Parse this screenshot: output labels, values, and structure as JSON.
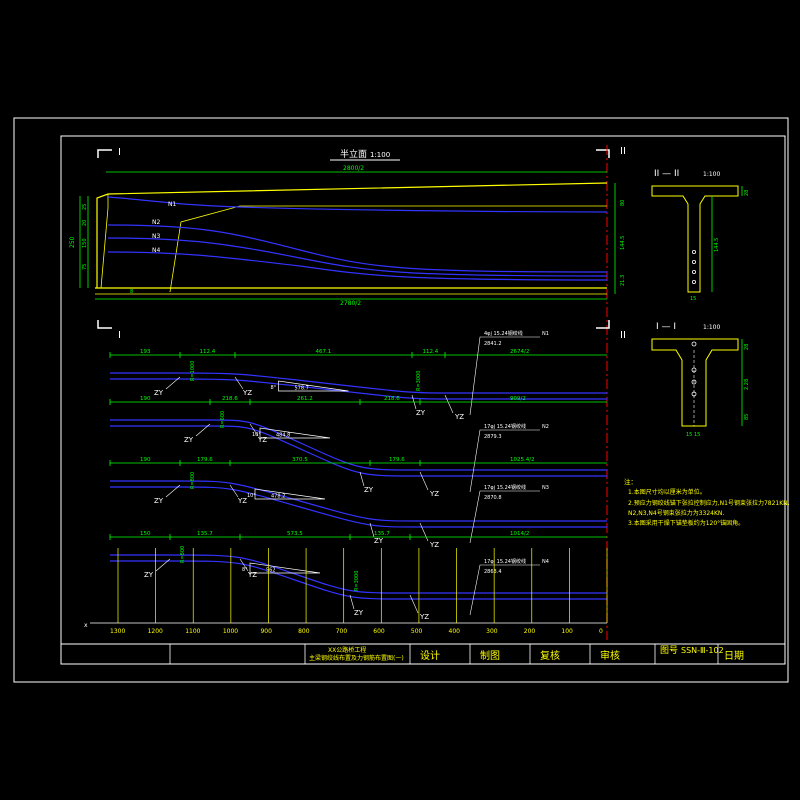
{
  "colors": {
    "background": "#000000",
    "border": "#ffffff",
    "frame": "#ffffff",
    "beam": "#ffff00",
    "tendon": "#3333ff",
    "dimension": "#00ff00",
    "text": "#ffffff",
    "note": "#ffff00",
    "centerline": "#ff0000"
  },
  "elevation": {
    "title": "半立面",
    "scale": "1:100",
    "top_length": "2800/2",
    "bottom_length": "2780/2",
    "left_marker": "I",
    "right_marker": "II",
    "tendons": [
      "N1",
      "N2",
      "N3",
      "N4"
    ],
    "left_dims": [
      "250",
      "25",
      "20",
      "150",
      "75",
      "80"
    ],
    "right_dims": [
      "45",
      "80",
      "144.5",
      "144.5",
      "12",
      "21.3",
      "5"
    ],
    "bottom_left_dim": "8"
  },
  "section_ii": {
    "title": "II — II",
    "scale": "1:100",
    "dims": [
      "28",
      "144.5",
      "144.5",
      "35",
      "15"
    ]
  },
  "section_i": {
    "title": "I — I",
    "scale": "1:100",
    "dims": [
      "28",
      "2.28",
      "85",
      "15 15"
    ]
  },
  "tendon_details": [
    {
      "dims_top": [
        "193",
        "112.4",
        "467.1",
        "112.4",
        "2674/2"
      ],
      "left_curve": "ZY",
      "right_curve": "YZ",
      "left_curve2": "ZY",
      "right_curve2": "YZ",
      "vertical_labels": [
        "R=1000",
        "R=3000"
      ],
      "triangle_label": "578.7",
      "triangle_side": "8°",
      "callout": "4φj 15.24钢绞线",
      "callout_value": "2841.2",
      "tag": "N1"
    },
    {
      "dims_top": [
        "190",
        "218.6",
        "261.2",
        "218.6",
        "909/2"
      ],
      "left_curve": "ZY",
      "right_curve": "YZ",
      "left_curve2": "ZY",
      "right_curve2": "YZ",
      "vertical_labels": [
        "R=600"
      ],
      "triangle_label": "484.8",
      "triangle_side": "10°",
      "callout": "17φj 15.24钢绞线",
      "callout_value": "2879.3",
      "tag": "N2"
    },
    {
      "dims_top": [
        "190",
        "179.6",
        "370.5",
        "179.6",
        "1025.4/2"
      ],
      "left_curve": "ZY",
      "right_curve": "YZ",
      "left_curve2": "ZY",
      "right_curve2": "YZ",
      "vertical_labels": [
        "R=800"
      ],
      "triangle_label": "478.2",
      "triangle_side": "10°",
      "callout": "17φj 15.24钢绞线",
      "callout_value": "2870.8",
      "tag": "N3"
    },
    {
      "dims_top": [
        "150",
        "135.7",
        "573.5",
        "135.7",
        "1014/2"
      ],
      "left_curve": "ZY",
      "right_curve": "YZ",
      "left_curve2": "ZY",
      "right_curve2": "YZ",
      "vertical_labels": [
        "R=800",
        "R=3000"
      ],
      "triangle_label": "562",
      "triangle_side": "8°",
      "callout": "17φj 15.24钢绞线",
      "callout_value": "2863.4",
      "tag": "N4"
    }
  ],
  "x_axis": {
    "label": "x",
    "ticks": [
      "1300",
      "1200",
      "1100",
      "1000",
      "900",
      "800",
      "700",
      "600",
      "500",
      "400",
      "300",
      "200",
      "100",
      "0"
    ]
  },
  "notes": {
    "heading": "注：",
    "lines": [
      "1.本图尺寸均以厘米为单位。",
      "2.预应力钢绞线锚下张拉控制应力,N1号钢束张拉力7821KN,",
      "  N2,N3,N4号钢束张拉力为3324KN.",
      "3.本图采用干燥下锚垫板约为120°锚固角。"
    ]
  },
  "title_block": {
    "project_line1": "XX公路桥工程",
    "project_line2": "主梁钢绞线布置及力钢筋布置图(一)",
    "design": "设计",
    "draw": "制图",
    "review": "复核",
    "approve": "审核",
    "drawing_no_label": "图号",
    "drawing_no": "SSN-Ⅲ-102",
    "date": "日期"
  }
}
